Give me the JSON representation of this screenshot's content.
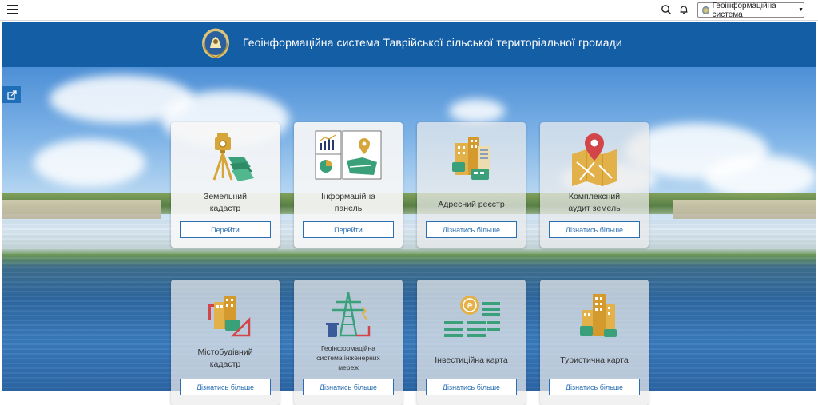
{
  "topbar": {
    "app_switch_label": "Геоінформаційна система"
  },
  "header": {
    "title": "Геоінформаційна система Таврійської сільської територіальної громади"
  },
  "cards": [
    {
      "label_line1": "Земельний",
      "label_line2": "кадастр",
      "button": "Перейти",
      "icon": "theodolite-icon"
    },
    {
      "label_line1": "Інформаційна",
      "label_line2": "панель",
      "button": "Перейти",
      "icon": "dashboard-map-icon"
    },
    {
      "label_line1": "Адресний реєстр",
      "label_line2": "",
      "button": "Дізнатись більше",
      "icon": "address-buildings-icon"
    },
    {
      "label_line1": "Комплексний",
      "label_line2": "аудит земель",
      "button": "Дізнатись більше",
      "icon": "map-pin-icon"
    },
    {
      "label_line1": "Містобудівний",
      "label_line2": "кадастр",
      "button": "Дізнатись більше",
      "icon": "urban-planning-icon"
    },
    {
      "label_line1": "Геоінформаційна",
      "label_line2": "система інженерних",
      "label_line3": "мереж",
      "button": "Дізнатись більше",
      "icon": "power-tower-icon"
    },
    {
      "label_line1": "Інвестиційна карта",
      "label_line2": "",
      "button": "Дізнатись більше",
      "icon": "coins-icon"
    },
    {
      "label_line1": "Туристична карта",
      "label_line2": "",
      "button": "Дізнатись більше",
      "icon": "hotel-icon"
    }
  ]
}
